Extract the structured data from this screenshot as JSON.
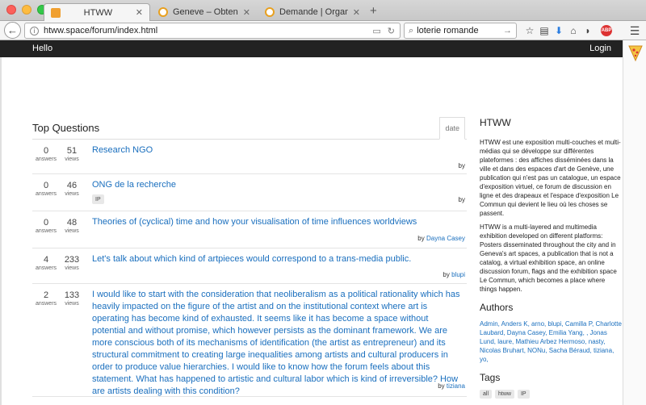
{
  "browser": {
    "tabs": [
      {
        "label": "HTWW",
        "favicon_color": "#f0a030"
      },
      {
        "label": "Geneve – Obtenir une con…",
        "favicon_color": "#e8a020"
      },
      {
        "label": "Demande | Organe genev…",
        "favicon_color": "#e8a020"
      }
    ],
    "new_tab": "+",
    "url": "htww.space/forum/index.html",
    "search_value": "loterie romande",
    "abp_label": "ABP"
  },
  "site": {
    "brand": "Hello",
    "login": "Login"
  },
  "questions": {
    "heading": "Top Questions",
    "sort_tab": "date",
    "answers_label": "answers",
    "views_label": "views",
    "items": [
      {
        "answers": "0",
        "views": "51",
        "title": "Research NGO",
        "by": "by",
        "author": "",
        "tag": ""
      },
      {
        "answers": "0",
        "views": "46",
        "title": "ONG de la recherche",
        "by": "by",
        "author": "",
        "tag": "IP"
      },
      {
        "answers": "0",
        "views": "48",
        "title": "Theories of (cyclical) time and how your visualisation of time influences worldviews",
        "by": "by",
        "author": "Dayna Casey",
        "tag": ""
      },
      {
        "answers": "4",
        "views": "233",
        "title": "Let's talk about which kind of artpieces would correspond to a trans-media public.",
        "by": "by",
        "author": "blupi",
        "tag": ""
      },
      {
        "answers": "2",
        "views": "133",
        "title": "I would like to start with the consideration that neoliberalism as a political rationality which has heavily impacted on the figure of the artist and on the institutional context where art is operating has become kind of exhausted. It seems like it has become a space without potential and without promise, which however persists as the dominant framework. We are more conscious both of its mechanisms of identification (the artist as entrepreneur) and its structural commitment to creating large inequalities among artists and cultural producers in order to produce value hierarchies. I would like to know how the forum feels about this statement. What has happened to artistic and cultural labor which is kind of irreversible? How are artists dealing with this condition?",
        "by": "by",
        "author": "tiziana",
        "tag": ""
      }
    ]
  },
  "sidebar": {
    "about_title": "HTWW",
    "about_fr": "HTWW est une exposition multi-couches et multi-médias qui se développe sur différentes plateformes : des affiches disséminées dans la ville et dans des espaces d'art de Genève, une publication qui n'est pas un catalogue, un espace d'exposition virtuel, ce forum de discussion en ligne et des drapeaux et l'espace d'exposition Le Commun qui devient le lieu où les choses se passent.",
    "about_en": "HTWW is a multi-layered and multimedia exhibition developed on different platforms: Posters disseminated throughout the city and in Geneva's art spaces, a publication that is not a catalog, a virtual exhibition space, an online discussion forum, flags and the exhibition space Le Commun, which becomes a place where things happen.",
    "authors_title": "Authors",
    "authors": "Admin, Anders K, arno, blupi, Camilla P, Charlotte Laubard, Dayna Casey, Emilia Yang, , Jonas Lund, laure, Mathieu Arbez Hermoso, nasty, Nicolas Bruhart, NONu, Sacha Béraud, tiziana, yo,",
    "tags_title": "Tags",
    "tags": [
      "all",
      "htww",
      "IP"
    ]
  }
}
